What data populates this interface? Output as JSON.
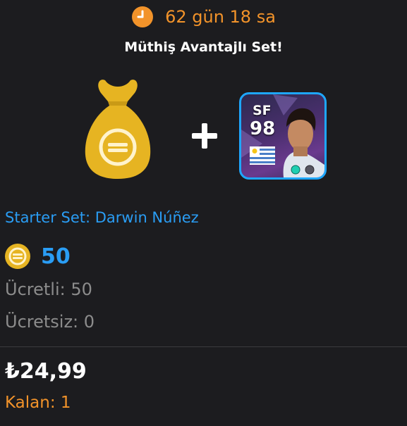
{
  "timer": {
    "text": "62 gün 18 sa",
    "icon": "clock-icon"
  },
  "set": {
    "title": "Müthiş Avantajlı Set!",
    "pack_name": "Starter Set: Darwin Núñez"
  },
  "card": {
    "position": "SF",
    "rating": "98"
  },
  "coins": {
    "amount": "50",
    "paid": "Ücretli: 50",
    "free": "Ücretsiz: 0"
  },
  "purchase": {
    "price": "₺24,99",
    "remaining": "Kalan: 1"
  },
  "colors": {
    "background": "#1c1c1f",
    "accent_orange": "#f2932a",
    "accent_blue": "#2a9df4",
    "muted_text": "#8c8c8c",
    "coin_gold": "#e6b422"
  }
}
